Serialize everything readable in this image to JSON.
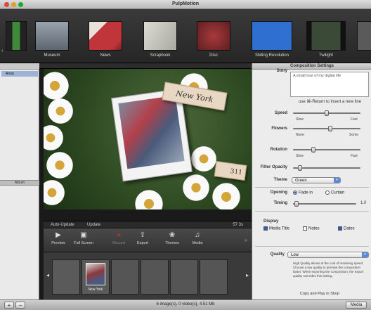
{
  "window": {
    "title": "PulpMotion"
  },
  "theme_strip": {
    "left_arrow": "‹",
    "items": [
      {
        "label": "",
        "color": "#3c8a3a"
      },
      {
        "label": "Museum",
        "color": "#6e7a86"
      },
      {
        "label": "News",
        "color": "#c0353a"
      },
      {
        "label": "Scrapbook",
        "color": "#c9c9c2"
      },
      {
        "label": "Disc",
        "color": "#7a2a2a"
      },
      {
        "label": "Sliding Revolution",
        "color": "#2f6fd0"
      },
      {
        "label": "Twilight",
        "color": "#3b4a36"
      },
      {
        "label": "",
        "color": "#5a5a5a"
      }
    ]
  },
  "left_panel": {
    "row_label": "Anna",
    "separator_label": "Album"
  },
  "preview": {
    "card_text": "New York",
    "number_text": "311",
    "update_bar": {
      "auto_update": "Auto-Update",
      "update": "Update",
      "duration": "57 3s"
    }
  },
  "toolbar": {
    "items": [
      {
        "label": "Preview",
        "icon": "▶"
      },
      {
        "label": "Full Screen",
        "icon": "▣"
      },
      {
        "label": "Record",
        "icon": "●"
      },
      {
        "label": "Export",
        "icon": "⇪"
      },
      {
        "label": "Themes",
        "icon": "❀"
      },
      {
        "label": "Media",
        "icon": "♫"
      }
    ],
    "more": "»"
  },
  "filmstrip": {
    "left_arrow": "◂",
    "right_arrow": "▸",
    "selected_caption": "New York"
  },
  "composition": {
    "header": "Composition Settings",
    "story_label": "Story",
    "story_text": "A small tour of my digital life",
    "hint": "use ⌘-Return to insert a new line",
    "speed": {
      "label": "Speed",
      "min": "Slow",
      "max": "Fast",
      "value": 0.5
    },
    "flowers": {
      "label": "Flowers",
      "min": "None",
      "max": "Some",
      "value": 0.55
    },
    "rotation": {
      "label": "Rotation",
      "min": "Slow",
      "max": "Fast",
      "value": 0.3
    },
    "filter_opacity": {
      "label": "Filter Opacity",
      "value": 0.1
    },
    "theme": {
      "label": "Theme",
      "value": "Green"
    },
    "opening": {
      "label": "Opening",
      "option_a": "Fade in",
      "option_b": "Curtain",
      "selected": "Fade in"
    },
    "timing": {
      "label": "Timing",
      "value_text": "1.0",
      "value": 0.05
    },
    "display": {
      "title": "Display",
      "media_title": "Media Title",
      "notes": "Notes",
      "dates": "Dates"
    },
    "quality": {
      "label": "Quality",
      "value": "Low",
      "note": "High Quality allows at the cost of rendering speed. Choose a low quality to preview the composition faster. When exporting the composition, the export quality overrides this setting."
    },
    "bottom_link": "Copy and Play in Shop"
  },
  "status": {
    "add": "+",
    "remove": "−",
    "summary": "6 image(s), 0 video(s), 4.51 Mb",
    "media_button": "Media"
  }
}
